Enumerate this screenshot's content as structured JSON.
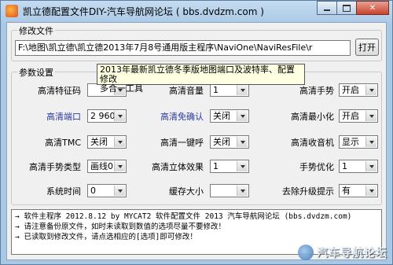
{
  "window": {
    "title": "凯立德配置文件DIY-汽车导航网论坛 ( bbs.dvdzm.com )",
    "close_label": "✕"
  },
  "file_group": {
    "label": "修改文件",
    "path_value": "F:\\地图\\凯立德\\凯立德2013年7月8号通用版主程序\\NaviOne\\NaviResFile\\r",
    "open_button": "打开"
  },
  "params_group": {
    "label": "参数设置",
    "rows": [
      [
        {
          "label": "高清特征码",
          "value": "",
          "blue": false
        },
        {
          "label": "高清音量",
          "value": "1",
          "blue": false
        },
        {
          "label": "高清手势",
          "value": "开启",
          "blue": false
        }
      ],
      [
        {
          "label": "高清端口",
          "value": "2 9600",
          "blue": true
        },
        {
          "label": "高清免确认",
          "value": "关闭",
          "blue": true
        },
        {
          "label": "高清最小化",
          "value": "开启",
          "blue": false
        }
      ],
      [
        {
          "label": "高清TMC",
          "value": "关闭",
          "blue": false
        },
        {
          "label": "高清一键呼",
          "value": "关闭",
          "blue": false
        },
        {
          "label": "高清收音机",
          "value": "显示",
          "blue": false
        }
      ],
      [
        {
          "label": "高清手势类型",
          "value": "画线0",
          "blue": false
        },
        {
          "label": "高清立体效果",
          "value": "1",
          "blue": false
        },
        {
          "label": "手势优化",
          "value": "1",
          "blue": false
        }
      ],
      [
        {
          "label": "系统时间",
          "value": "0",
          "blue": false
        },
        {
          "label": "缓存大小",
          "value": "",
          "blue": false
        },
        {
          "label": "去除升级提示",
          "value": "有",
          "blue": false
        }
      ]
    ]
  },
  "tooltip": {
    "line1": "2013年最新凯立德冬季版地图端口及波特率、配置修改",
    "line2": "多合一工具"
  },
  "log": {
    "lines": [
      "→ 软件主程序 2012.8.12 by MYCAT2    软件配置文件 2013 汽车导航网论坛 (bbs.dvdzm.com)",
      "→ 请注意备份原文件，如时未读取到数值的选项尽量不要修改！",
      "→ 已读取到修改文件，请点选相应的[选项]即可修改！"
    ]
  },
  "watermark": {
    "text": "汽车导航论坛"
  }
}
